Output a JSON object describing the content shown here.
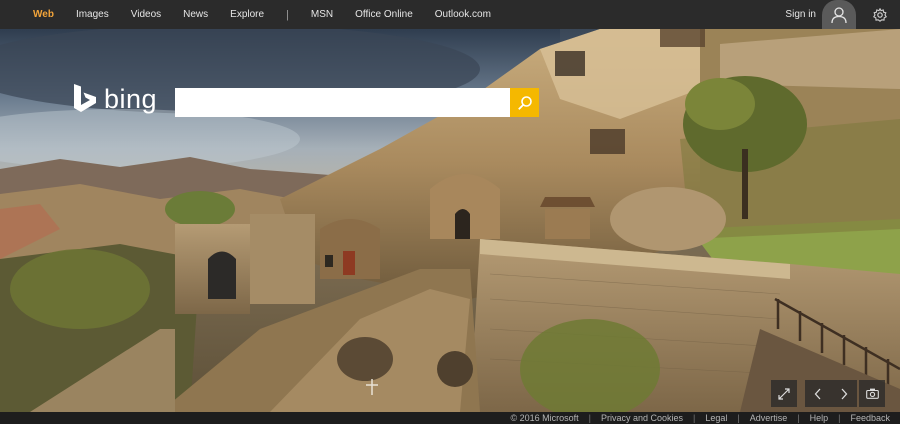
{
  "nav": {
    "items": [
      {
        "label": "Web",
        "active": true
      },
      {
        "label": "Images"
      },
      {
        "label": "Videos"
      },
      {
        "label": "News"
      },
      {
        "label": "Explore"
      }
    ],
    "separator": "|",
    "services": [
      {
        "label": "MSN"
      },
      {
        "label": "Office Online"
      },
      {
        "label": "Outlook.com"
      }
    ]
  },
  "account": {
    "signin_label": "Sign in",
    "avatar_icon": "user-icon",
    "settings_icon": "gear-icon"
  },
  "brand": {
    "logo_text": "bing",
    "accent": "#f5b800",
    "nav_active_color": "#f2a43a"
  },
  "search": {
    "value": "",
    "placeholder": "",
    "button_icon": "search-icon"
  },
  "controls": {
    "expand_icon": "expand-icon",
    "prev_icon": "chevron-left-icon",
    "next_icon": "chevron-right-icon",
    "camera_icon": "camera-icon"
  },
  "footer": {
    "copyright": "© 2016 Microsoft",
    "links": [
      "Privacy and Cookies",
      "Legal",
      "Advertise",
      "Help",
      "Feedback"
    ]
  }
}
